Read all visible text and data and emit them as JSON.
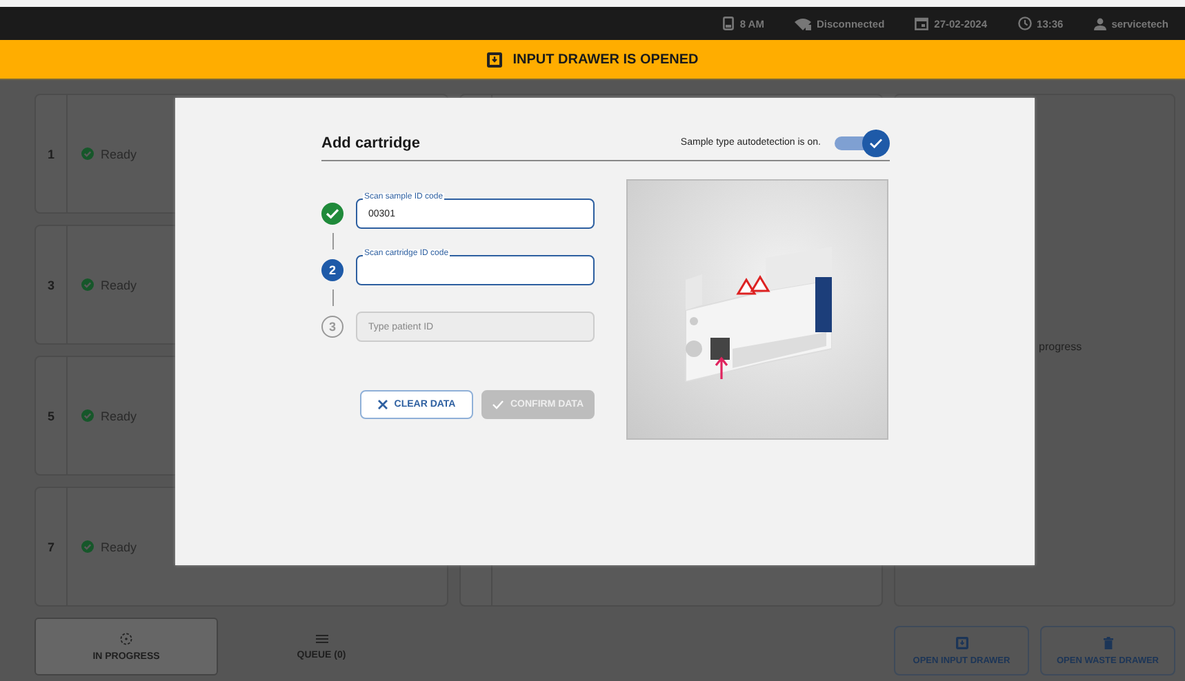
{
  "status_bar": [
    {
      "kind": "battery",
      "text": "8 AM"
    },
    {
      "kind": "wifi_off",
      "text": "Disconnected"
    },
    {
      "kind": "calendar",
      "text": "27-02-2024"
    },
    {
      "kind": "clock",
      "text": "13:36"
    },
    {
      "kind": "user",
      "text": "servicetech"
    }
  ],
  "banner": {
    "text": "INPUT DRAWER IS OPENED"
  },
  "slots": [
    {
      "number": "1",
      "status": "Ready"
    },
    {
      "number": "3",
      "status": "Ready"
    },
    {
      "number": "5",
      "status": "Ready"
    },
    {
      "number": "7",
      "status": "Ready"
    }
  ],
  "side_panel": {
    "text": "progress"
  },
  "dialog": {
    "title": "Add cartridge",
    "autodetect_label": "Sample type autodetection is on.",
    "autodetect_on": true,
    "steps": [
      {
        "completed": true,
        "current": false,
        "label": "Scan sample ID code",
        "value": "00301",
        "disabled": false
      },
      {
        "completed": false,
        "current": true,
        "number": "2",
        "label": "Scan cartridge ID code",
        "disabled": false
      },
      {
        "completed": false,
        "current": false,
        "number": "3",
        "placeholder": "Type patient ID",
        "disabled": true
      }
    ],
    "buttons": [
      {
        "kind": "clear",
        "label": "CLEAR DATA",
        "disabled": false
      },
      {
        "kind": "confirm",
        "label": "CONFIRM DATA",
        "disabled": true
      }
    ]
  },
  "nav_tabs": [
    {
      "kind": "progress",
      "label": "IN PROGRESS",
      "selected": true
    },
    {
      "kind": "queue",
      "label": "QUEUE (0)",
      "selected": false
    }
  ],
  "actions": [
    {
      "kind": "input",
      "label": "OPEN INPUT DRAWER"
    },
    {
      "kind": "waste",
      "label": "OPEN WASTE DRAWER"
    }
  ]
}
